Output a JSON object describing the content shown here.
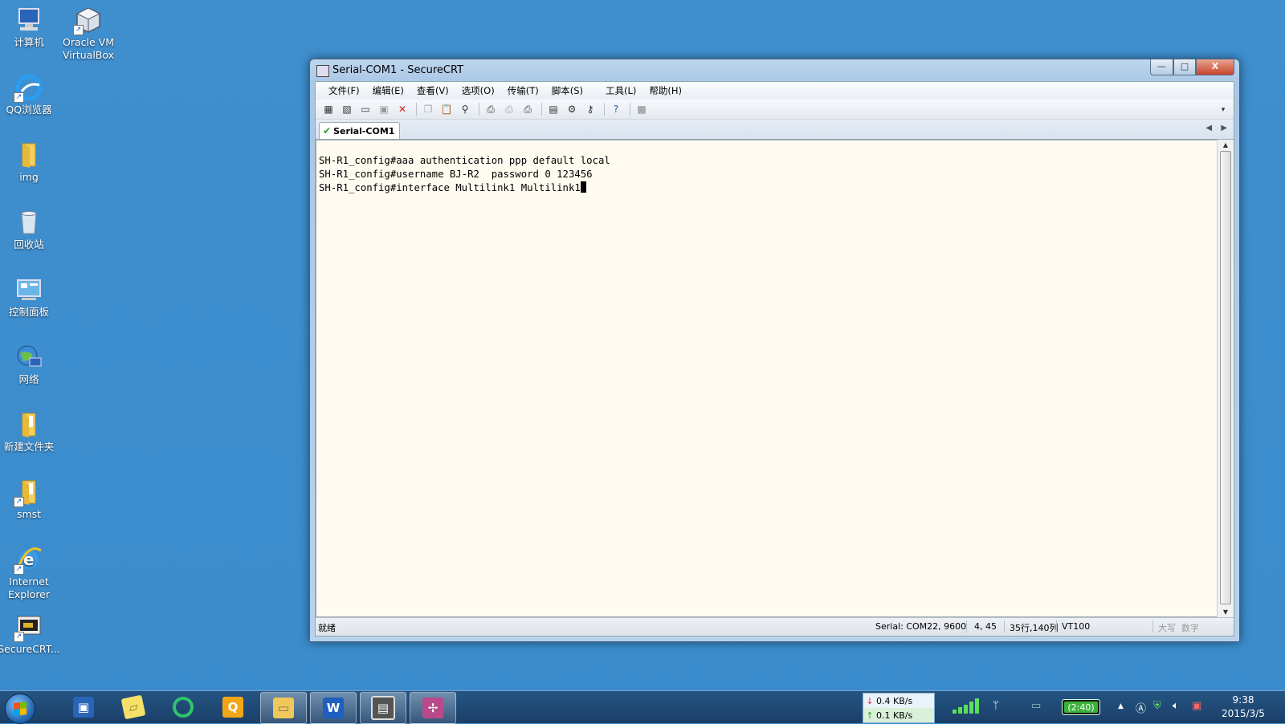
{
  "desktop": {
    "icons": [
      {
        "label_line1": "计算机",
        "label_line2": ""
      },
      {
        "label_line1": "Oracle VM",
        "label_line2": "VirtualBox"
      },
      {
        "label_line1": "QQ浏览器",
        "label_line2": ""
      },
      {
        "label_line1": "img",
        "label_line2": ""
      },
      {
        "label_line1": "回收站",
        "label_line2": ""
      },
      {
        "label_line1": "控制面板",
        "label_line2": ""
      },
      {
        "label_line1": "网络",
        "label_line2": ""
      },
      {
        "label_line1": "新建文件夹",
        "label_line2": ""
      },
      {
        "label_line1": "smst",
        "label_line2": ""
      },
      {
        "label_line1": "Internet",
        "label_line2": "Explorer"
      },
      {
        "label_line1": "SecureCRT...",
        "label_line2": ""
      }
    ]
  },
  "window": {
    "title": "Serial-COM1 - SecureCRT",
    "controls": {
      "minimize": "—",
      "maximize": "□",
      "close": "X"
    },
    "menu": [
      "文件(F)",
      "编辑(E)",
      "查看(V)",
      "选项(O)",
      "传输(T)",
      "脚本(S)",
      "工具(L)",
      "帮助(H)"
    ],
    "tab_label": "Serial-COM1",
    "terminal_lines": [
      "SH-R1_config#aaa authentication ppp default local",
      "SH-R1_config#username BJ-R2  password 0 123456",
      "SH-R1_config#interface Multilink1 Multilink1"
    ],
    "status": {
      "ready": "就绪",
      "connection": "Serial: COM22, 9600",
      "cursor_pos": "4, 45",
      "size": "35行,140列",
      "emulation": "VT100",
      "caps": "大写",
      "num": "数字"
    }
  },
  "taskbar": {
    "net_down": "0.4 KB/s",
    "net_up": "0.1 KB/s",
    "battery": "(2:40)",
    "time": "9:38",
    "date": "2015/3/5"
  }
}
